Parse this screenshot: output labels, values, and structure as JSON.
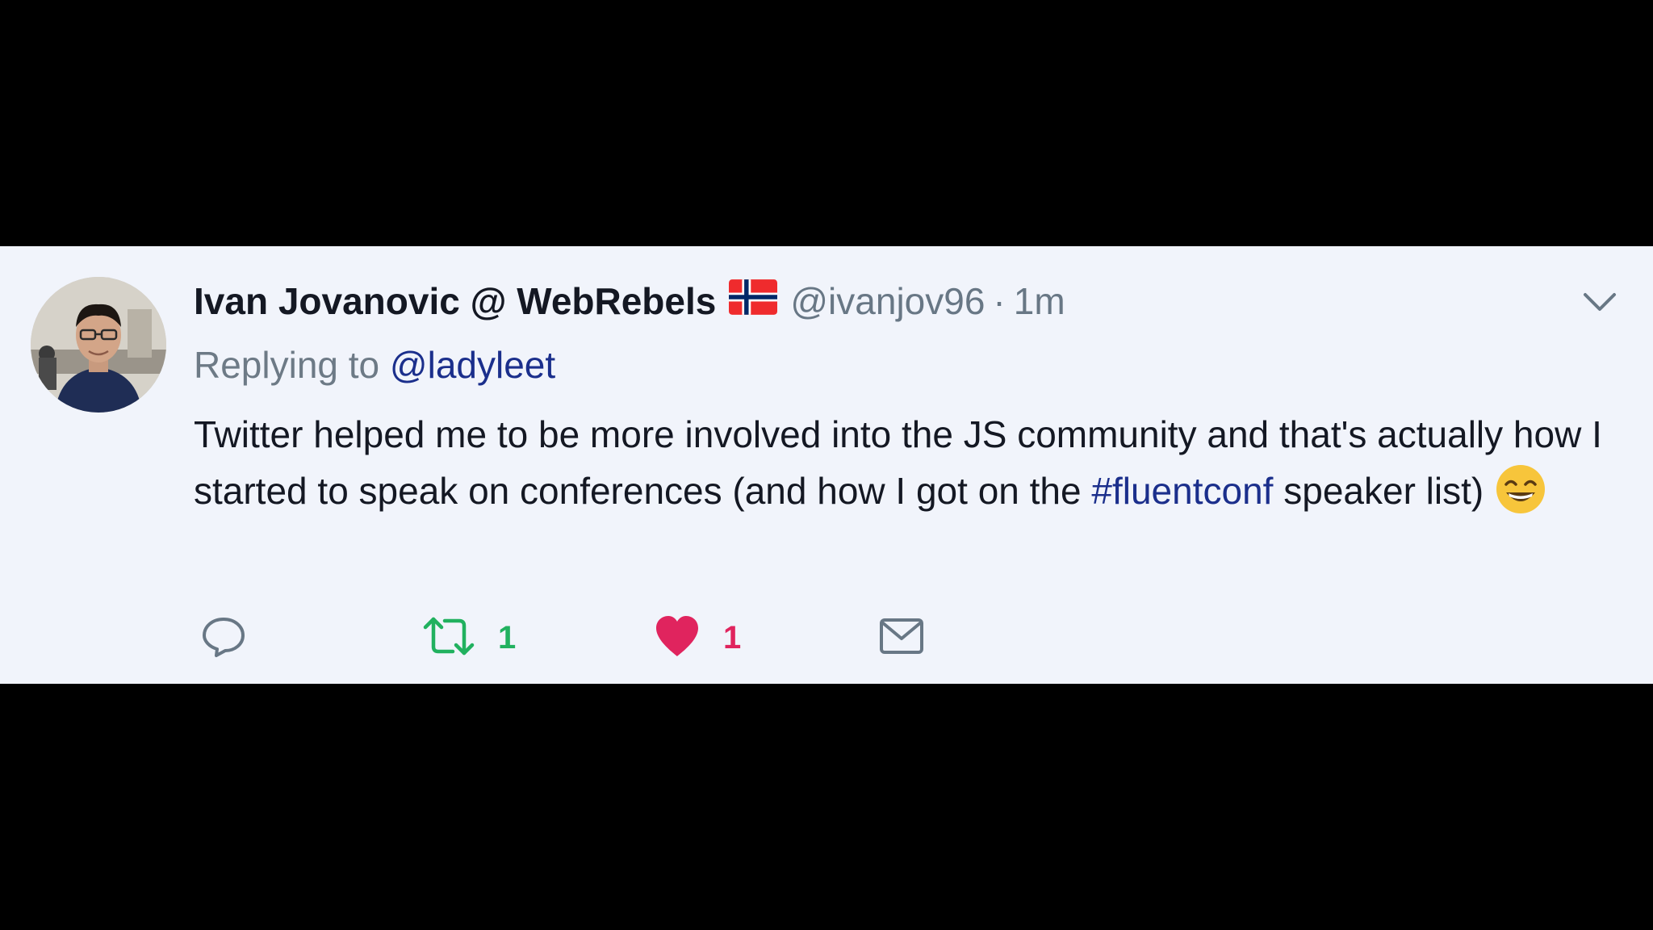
{
  "tweet": {
    "display_name": "Ivan Jovanovic @ WebRebels",
    "flag": "norway-flag",
    "handle": "@ivanjov96",
    "separator": "·",
    "timestamp": "1m",
    "replying_prefix": "Replying to",
    "replying_to": "@ladyleet",
    "text_part1": "Twitter helped me to be more involved into the JS community and that's actually how I started to speak on conferences (and how I got on the",
    "hashtag": "#fluentconf",
    "text_part2": "speaker list)",
    "emoji": "grinning-face-with-smiling-eyes",
    "retweet_count": "1",
    "like_count": "1"
  },
  "icons": {
    "reply": "reply-icon",
    "retweet": "retweet-icon",
    "like": "heart-icon",
    "dm": "envelope-icon",
    "caret": "chevron-down-icon"
  },
  "colors": {
    "card_background": "#f1f4fb",
    "link": "#1b2f8c",
    "retweet": "#21b15f",
    "like": "#e0245e",
    "secondary_text": "#687785"
  }
}
